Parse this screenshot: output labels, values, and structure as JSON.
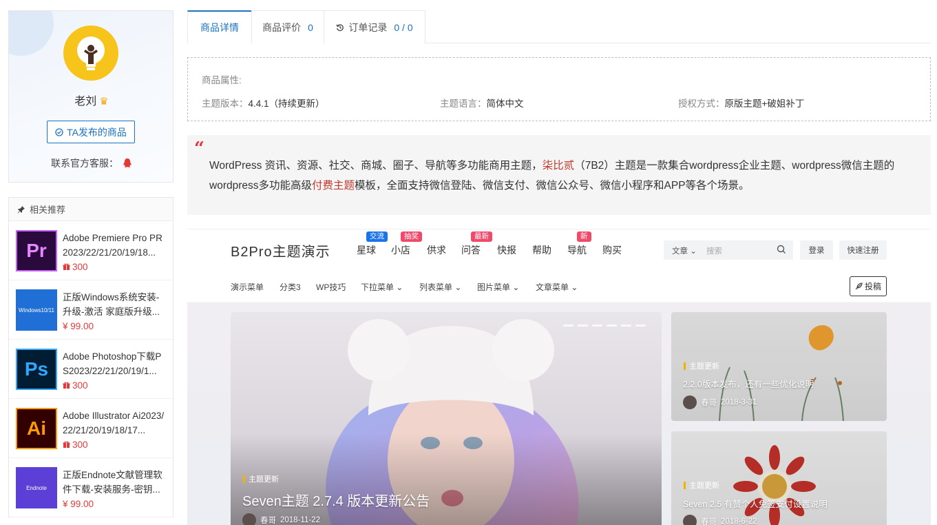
{
  "author": {
    "name": "老刘",
    "products_button": "TA发布的商品",
    "contact_label": "联系官方客服："
  },
  "related": {
    "heading": "相关推荐",
    "items": [
      {
        "title": "Adobe Premiere Pro PR 2023/22/21/20/19/18...",
        "price": "300",
        "price_kind": "gift-points",
        "thumb": "Pr",
        "thumb_bg": "#2a0a3c",
        "thumb_fg": "#e588ff",
        "thumb_border": "#c95eff"
      },
      {
        "title": "正版Windows系统安装-升级-激活 家庭版升级...",
        "price": "¥ 99.00",
        "price_kind": "money",
        "thumb": "Windows10/11",
        "thumb_bg": "#1f6fd6",
        "thumb_fg": "#ffffff",
        "thumb_border": "#1f6fd6"
      },
      {
        "title": "Adobe Photoshop下载PS2023/22/21/20/19/1...",
        "price": "300",
        "price_kind": "gift-points",
        "thumb": "Ps",
        "thumb_bg": "#001d34",
        "thumb_fg": "#31a8ff",
        "thumb_border": "#31a8ff"
      },
      {
        "title": "Adobe Illustrator Ai2023/22/21/20/19/18/17...",
        "price": "300",
        "price_kind": "gift-points",
        "thumb": "Ai",
        "thumb_bg": "#330000",
        "thumb_fg": "#ff9a00",
        "thumb_border": "#ff9a00"
      },
      {
        "title": "正版Endnote文献管理软件下载-安装服务-密钥...",
        "price": "¥ 99.00",
        "price_kind": "money",
        "thumb": "Endnote",
        "thumb_bg": "#5b3fd6",
        "thumb_fg": "#ffffff",
        "thumb_border": "#5b3fd6"
      }
    ]
  },
  "tabs": [
    {
      "label": "商品详情",
      "count": ""
    },
    {
      "label": "商品评价",
      "count": "0"
    },
    {
      "label": "订单记录",
      "count": "0 / 0"
    }
  ],
  "attributes": {
    "title": "商品属性:",
    "items": [
      {
        "key": "主题版本：",
        "value": "4.4.1（持续更新）"
      },
      {
        "key": "主题语言：",
        "value": "简体中文"
      },
      {
        "key": "授权方式：",
        "value": "原版主题+破姐补丁"
      }
    ]
  },
  "quote": {
    "mark": "“",
    "part1": "WordPress 资讯、资源、社交、商城、圈子、导航等多功能商用主题，",
    "hl1": "柒比贰",
    "part2": "（7B2）主题是一款集合wordpress企业主题、wordpress微信主题的wordpress多功能高级",
    "hl2": "付费主题",
    "part3": "模板，全面支持微信登陆、微信支付、微信公众号、微信小程序和APP等各个场景。"
  },
  "preview": {
    "logo": "B2Pro主题演示",
    "nav": [
      {
        "label": "星球",
        "badge": "交流",
        "badge_color": "#1a73e8"
      },
      {
        "label": "小店",
        "badge": "抽奖",
        "badge_color": "#f04a6a"
      },
      {
        "label": "供求",
        "badge": "",
        "badge_color": ""
      },
      {
        "label": "问答",
        "badge": "最新",
        "badge_color": "#f04a6a"
      },
      {
        "label": "快报",
        "badge": "",
        "badge_color": ""
      },
      {
        "label": "帮助",
        "badge": "",
        "badge_color": ""
      },
      {
        "label": "导航",
        "badge": "新",
        "badge_color": "#f04a6a"
      },
      {
        "label": "购买",
        "badge": "",
        "badge_color": ""
      }
    ],
    "search_category": "文章",
    "search_placeholder": "搜索",
    "login": "登录",
    "register": "快速注册",
    "subnav": [
      "演示菜单",
      "分类3",
      "WP技巧",
      "下拉菜单",
      "列表菜单",
      "图片菜单",
      "文章菜单"
    ],
    "post_button": "投稿",
    "main_slide": {
      "tag": "主题更新",
      "title": "Seven主题 2.7.4 版本更新公告",
      "author": "春哥",
      "date": "2018-11-22"
    },
    "side_slides": [
      {
        "tag": "主题更新",
        "title": "2.2.0版本发布，还有一些优化说明",
        "author": "春哥",
        "date": "2018-3-31"
      },
      {
        "tag": "主题更新",
        "title": "Seven 2.5 有赞个人免签支付设置说明",
        "author": "春哥",
        "date": "2018-6-22"
      }
    ]
  },
  "colors": {
    "accent": "#1a72c0",
    "price": "#e4393c",
    "highlight": "#c0392b"
  }
}
